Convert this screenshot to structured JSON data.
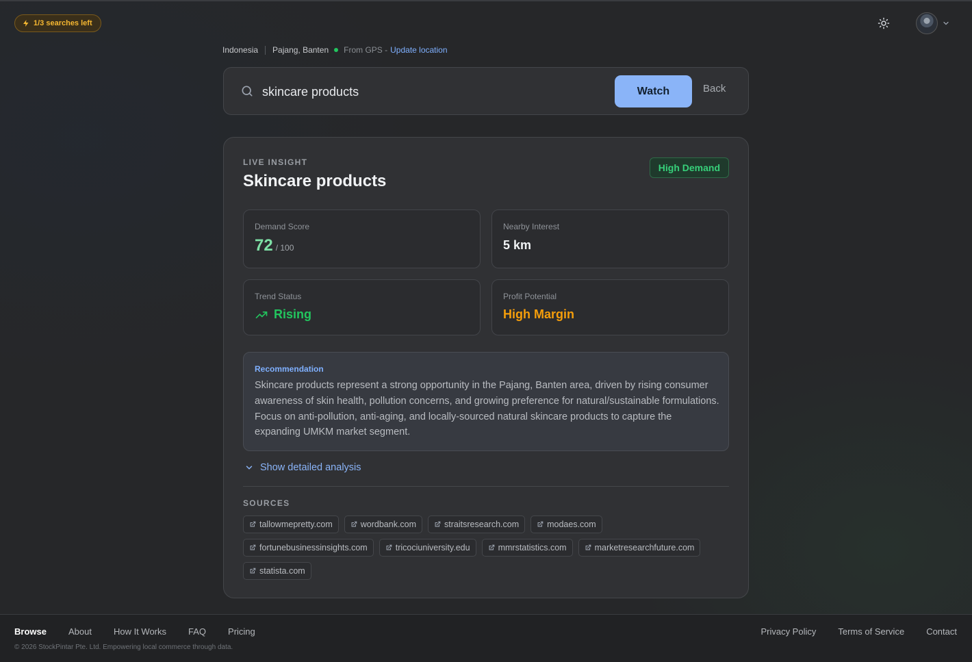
{
  "header": {
    "searches_left": "1/3 searches left",
    "theme_icon": "sun-icon",
    "avatar_icon": "user-avatar",
    "dropdown_icon": "chevron-down-icon"
  },
  "location": {
    "country": "Indonesia",
    "region": "Pajang, Banten",
    "source": "From GPS -",
    "update_link": "Update location",
    "status_color": "#22c55e"
  },
  "search": {
    "query": "skincare products",
    "watch_label": "Watch",
    "back_label": "Back"
  },
  "insight": {
    "eyebrow": "LIVE INSIGHT",
    "title": "Skincare products",
    "badge": "High Demand",
    "metrics": {
      "demand_label": "Demand Score",
      "demand_value": "72",
      "demand_max": "/ 100",
      "interest_label": "Nearby Interest",
      "interest_value": "5 km",
      "trend_label": "Trend Status",
      "trend_value": "Rising",
      "profit_label": "Profit Potential",
      "profit_value": "High Margin"
    },
    "recommendation": {
      "title": "Recommendation",
      "text": "Skincare products represent a strong opportunity in the Pajang, Banten area, driven by rising consumer awareness of skin health, pollution concerns, and growing preference for natural/sustainable formulations. Focus on anti-pollution, anti-aging, and locally-sourced natural skincare products to capture the expanding UMKM market segment."
    },
    "toggle_label": "Show detailed analysis",
    "sources_label": "SOURCES",
    "sources": [
      "tallowmepretty.com",
      "wordbank.com",
      "straitsresearch.com",
      "modaes.com",
      "fortunebusinessinsights.com",
      "tricociuniversity.edu",
      "mmrstatistics.com",
      "marketresearchfuture.com",
      "statista.com"
    ]
  },
  "footer": {
    "nav": [
      "Browse",
      "About",
      "How It Works",
      "FAQ",
      "Pricing"
    ],
    "legal": [
      "Privacy Policy",
      "Terms of Service",
      "Contact"
    ],
    "copyright": "© 2026 StockPintar Pte. Ltd. Empowering local commerce through data."
  }
}
